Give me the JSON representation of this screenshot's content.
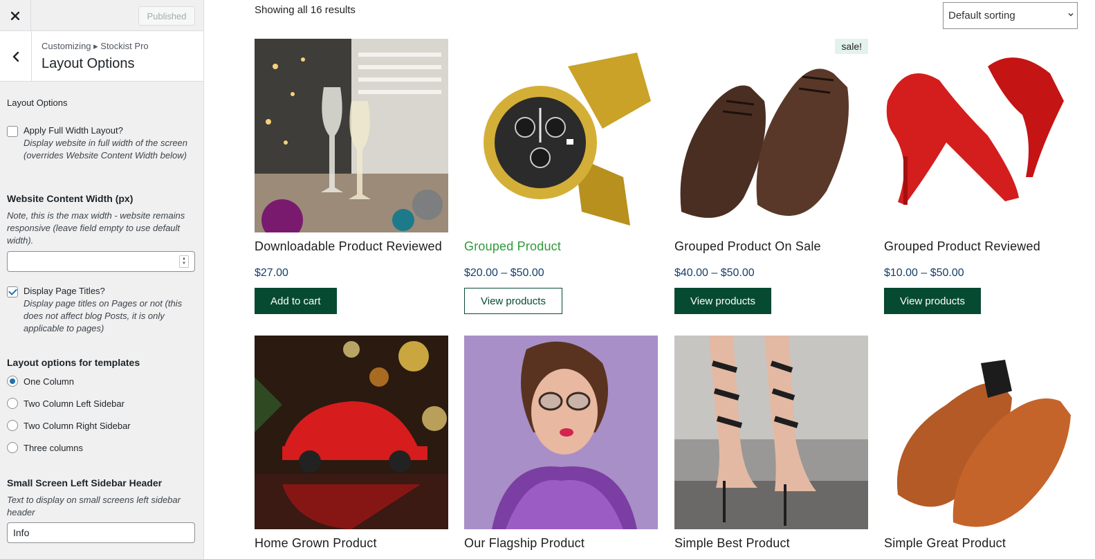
{
  "customizer": {
    "publish_label": "Published",
    "breadcrumb": "Customizing ▸ Stockist Pro",
    "section_title": "Layout Options",
    "controls": {
      "heading": "Layout Options",
      "full_width": {
        "label": "Apply Full Width Layout?",
        "desc": "Display website in full width of the screen (overrides Website Content Width below)",
        "checked": false
      },
      "content_width": {
        "title": "Website Content Width (px)",
        "desc": "Note, this is the max width - website remains responsive (leave field empty to use default width).",
        "value": ""
      },
      "page_titles": {
        "label": "Display Page Titles?",
        "desc": "Display page titles on Pages or not (this does not affect blog Posts, it is only applicable to pages)",
        "checked": true
      },
      "templates": {
        "title": "Layout options for templates",
        "options": [
          "One Column",
          "Two Column Left Sidebar",
          "Two Column Right Sidebar",
          "Three columns"
        ],
        "selected": "One Column"
      },
      "small_header": {
        "title": "Small Screen Left Sidebar Header",
        "desc": "Text to display on small screens left sidebar header",
        "value": "Info"
      }
    }
  },
  "shop": {
    "results_text": "Showing all 16 results",
    "sort_selected": "Default sorting",
    "products": [
      {
        "name": "Downloadable Product Reviewed",
        "price": "$27.00",
        "button": "Add to cart",
        "image": "wine-glasses-photo"
      },
      {
        "name": "Grouped Product",
        "price": "$20.00 – $50.00",
        "button": "View products",
        "image": "gold-watch-photo"
      },
      {
        "name": "Grouped Product On Sale",
        "price": "$40.00 – $50.00",
        "button": "View products",
        "image": "brown-oxford-shoes-photo",
        "badge": "sale!"
      },
      {
        "name": "Grouped Product Reviewed",
        "price": "$10.00 – $50.00",
        "button": "View products",
        "image": "red-heels-photo"
      },
      {
        "name": "Home Grown Product",
        "image": "red-toy-car-photo"
      },
      {
        "name": "Our Flagship Product",
        "image": "woman-sunglasses-photo"
      },
      {
        "name": "Simple Best Product",
        "image": "strappy-heels-photo"
      },
      {
        "name": "Simple Great Product",
        "image": "tan-loafers-photo"
      }
    ]
  },
  "colors": {
    "accent_green": "#064a32",
    "price_blue": "#143f6b",
    "link_green": "#2e9a3a",
    "wp_blue": "#2271b1"
  }
}
